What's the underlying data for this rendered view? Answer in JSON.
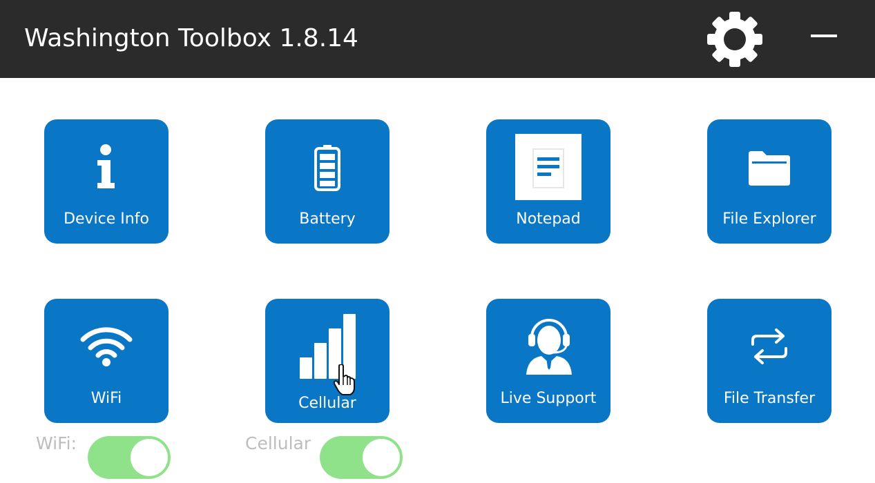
{
  "window": {
    "title": "Washington Toolbox 1.8.14",
    "settings_icon": "gear-icon",
    "minimize_icon": "minimize-icon"
  },
  "tiles": [
    {
      "label": "Device Info",
      "icon": "info-icon"
    },
    {
      "label": "Battery",
      "icon": "battery-icon"
    },
    {
      "label": "Notepad",
      "icon": "notepad-icon"
    },
    {
      "label": "File Explorer",
      "icon": "folder-icon"
    },
    {
      "label": "WiFi",
      "icon": "wifi-icon"
    },
    {
      "label": "Cellular",
      "icon": "cellular-signal-icon"
    },
    {
      "label": "Live Support",
      "icon": "support-agent-icon"
    },
    {
      "label": "File Transfer",
      "icon": "transfer-arrows-icon"
    }
  ],
  "toggles": {
    "wifi": {
      "label": "WiFi:",
      "state": "on"
    },
    "cellular": {
      "label": "Cellular",
      "state": "on"
    }
  },
  "colors": {
    "titlebar": "#2b2b2b",
    "tile": "#0a76c6",
    "toggle_on": "#8fe28a",
    "toggle_label": "#bdbdbd"
  }
}
